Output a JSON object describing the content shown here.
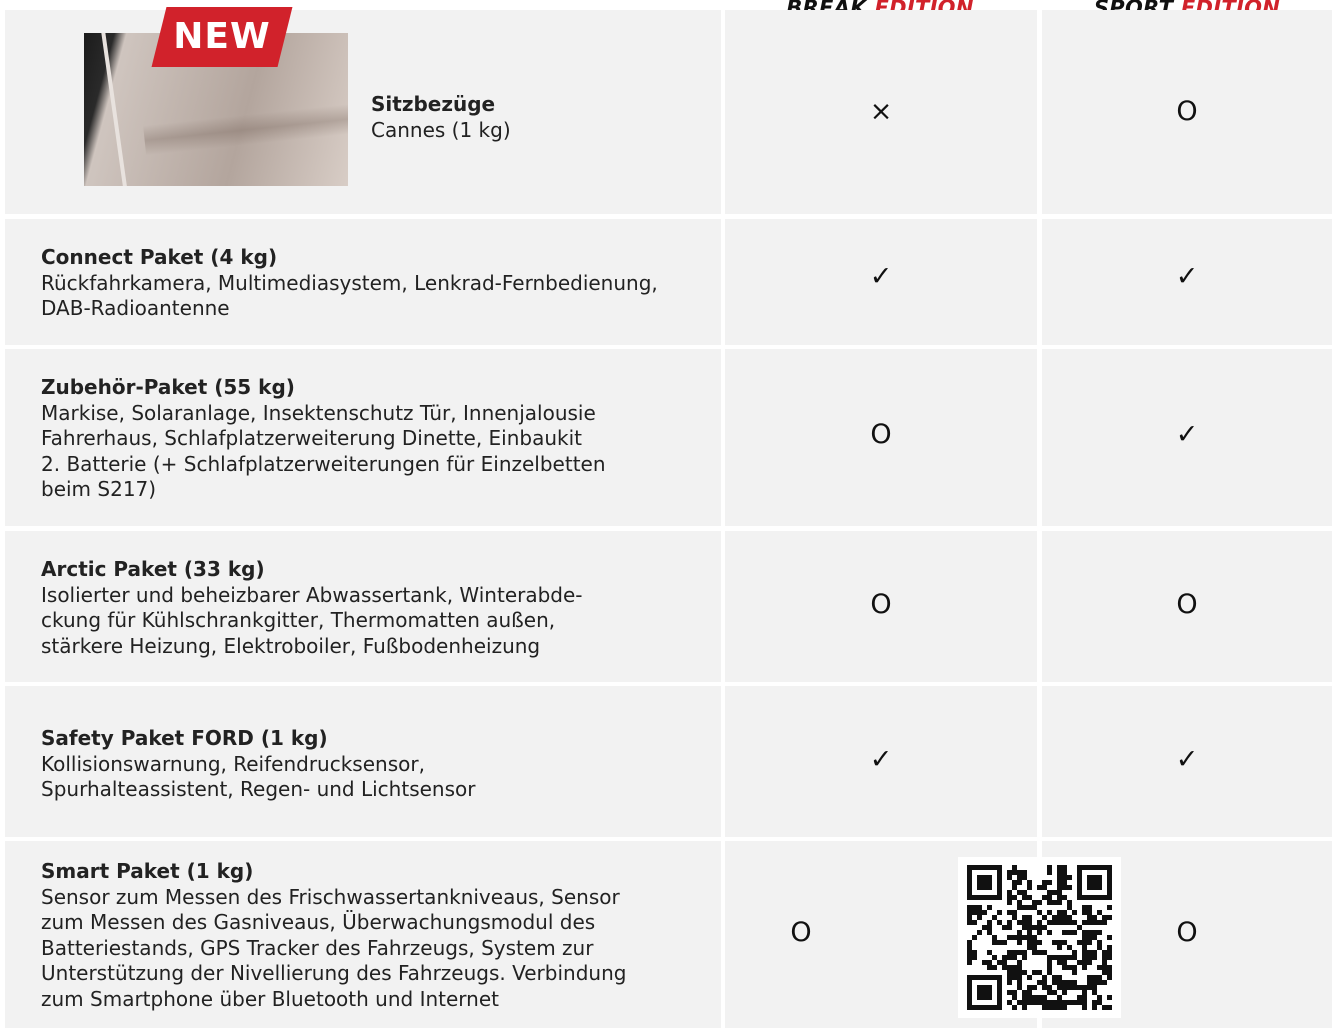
{
  "columns": {
    "break": {
      "word": "BREAK",
      "accent": "EDITION"
    },
    "sport": {
      "word": "SPORT",
      "accent": "EDITION"
    }
  },
  "badge": {
    "label": "NEW"
  },
  "colors": {
    "accent": "#d1222b",
    "cell_bg": "#f2f2f2"
  },
  "rows": [
    {
      "title": "Sitzbezüge",
      "text": "Cannes (1 kg)",
      "break": "×",
      "sport": "O"
    },
    {
      "title": "Connect Paket (4 kg)",
      "text": "Rückfahrkamera, Multimediasystem, Lenkrad-Fernbedienung,\nDAB-Radioantenne",
      "break": "✓",
      "sport": "✓"
    },
    {
      "title": "Zubehör-Paket (55 kg)",
      "text": "Markise, Solaranlage, Insektenschutz Tür, Innenjalousie\nFahrerhaus, Schlafplatzerweiterung Dinette, Einbaukit\n2. Batterie (+ Schlafplatzerweiterungen für Einzelbetten\nbeim S217)",
      "break": "O",
      "sport": "✓"
    },
    {
      "title": "Arctic Paket (33 kg)",
      "text": "Isolierter und beheizbarer Abwassertank, Winterabde-\nckung für Kühlschrankgitter, Thermomatten außen,\nstärkere Heizung, Elektroboiler, Fußbodenheizung",
      "break": "O",
      "sport": "O"
    },
    {
      "title": "Safety Paket FORD (1 kg)",
      "text": "Kollisionswarnung, Reifendrucksensor,\nSpurhalteassistent, Regen- und Lichtsensor",
      "break": "✓",
      "sport": "✓"
    },
    {
      "title": "Smart Paket (1 kg)",
      "text": "Sensor zum Messen des Frischwassertankniveaus, Sensor\nzum Messen des Gasniveaus, Überwachungsmodul des\nBatteriestands, GPS Tracker des Fahrzeugs, System zur\nUnterstützung der Nivellierung des Fahrzeugs. Verbindung\nzum Smartphone über Bluetooth und Internet",
      "break": "O",
      "sport": "O"
    }
  ]
}
